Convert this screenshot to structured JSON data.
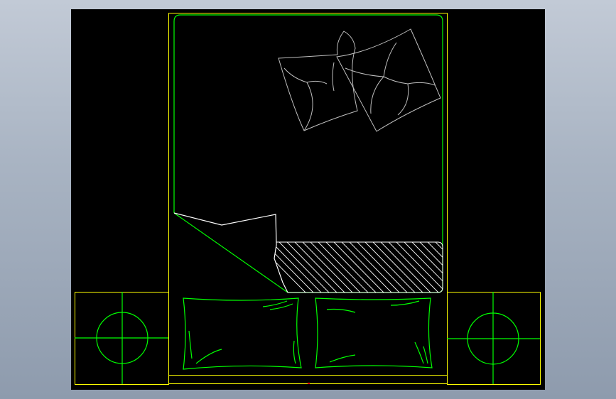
{
  "colors": {
    "background": "#000000",
    "outline": "#ffff00",
    "bed_linework": "#00ff00",
    "pillow_sketch": "#bfbfbf",
    "sheet_edge": "#ffffff",
    "marker": "#ff0000"
  },
  "icons": {
    "left_lamp": "crosshair-circle-icon",
    "right_lamp": "crosshair-circle-icon"
  }
}
